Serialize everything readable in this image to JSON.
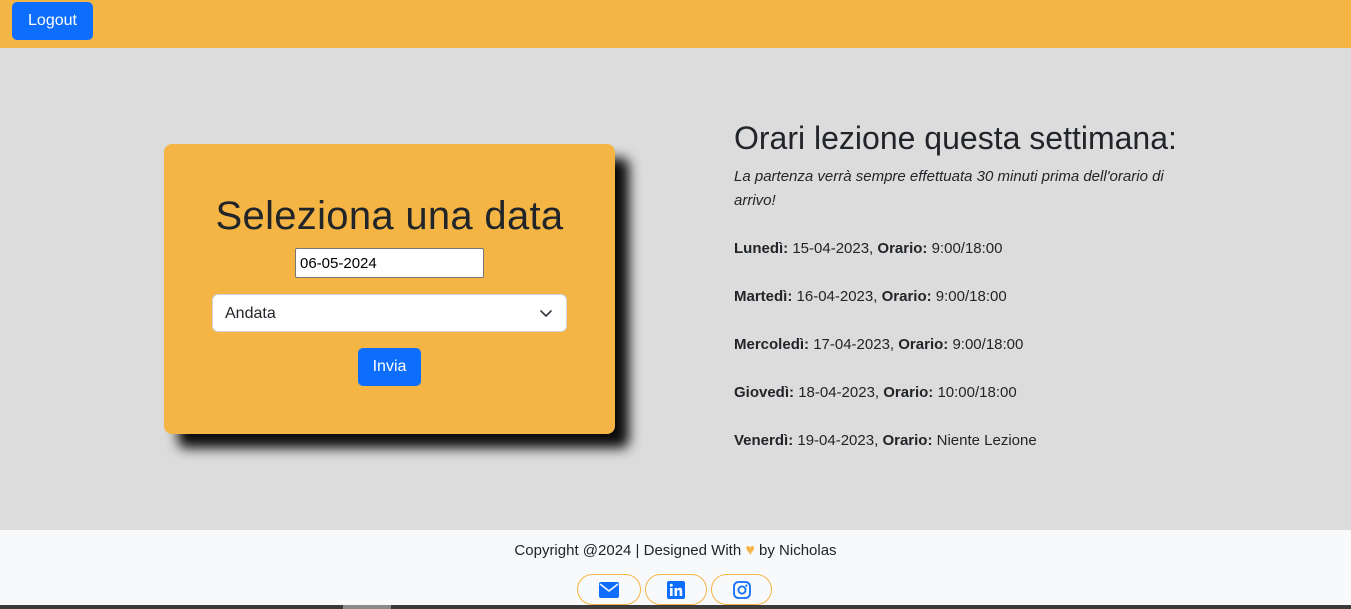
{
  "header": {
    "logout_label": "Logout"
  },
  "form": {
    "title": "Seleziona una data",
    "date_value": "06-05-2024",
    "select_value": "Andata",
    "submit_label": "Invia"
  },
  "schedule": {
    "title": "Orari lezione questa settimana:",
    "note": "La partenza verrà sempre effettuata 30 minuti prima dell'orario di arrivo!",
    "time_label": "Orario:",
    "days": [
      {
        "day": "Lunedì:",
        "date": "15-04-2023,",
        "time": "9:00/18:00"
      },
      {
        "day": "Martedì:",
        "date": "16-04-2023,",
        "time": "9:00/18:00"
      },
      {
        "day": "Mercoledì:",
        "date": "17-04-2023,",
        "time": "9:00/18:00"
      },
      {
        "day": "Giovedì:",
        "date": "18-04-2023,",
        "time": "10:00/18:00"
      },
      {
        "day": "Venerdì:",
        "date": "19-04-2023,",
        "time": "Niente Lezione"
      }
    ]
  },
  "footer": {
    "copyright_prefix": "Copyright @2024 | Designed With",
    "copyright_suffix": "by Nicholas",
    "icons": [
      "envelope-icon",
      "linkedin-icon",
      "instagram-icon"
    ]
  },
  "colors": {
    "accent": "#f4b544",
    "primary": "#0d6efd",
    "background": "#dcdcdc",
    "footer_bg": "#f8f9fa"
  }
}
